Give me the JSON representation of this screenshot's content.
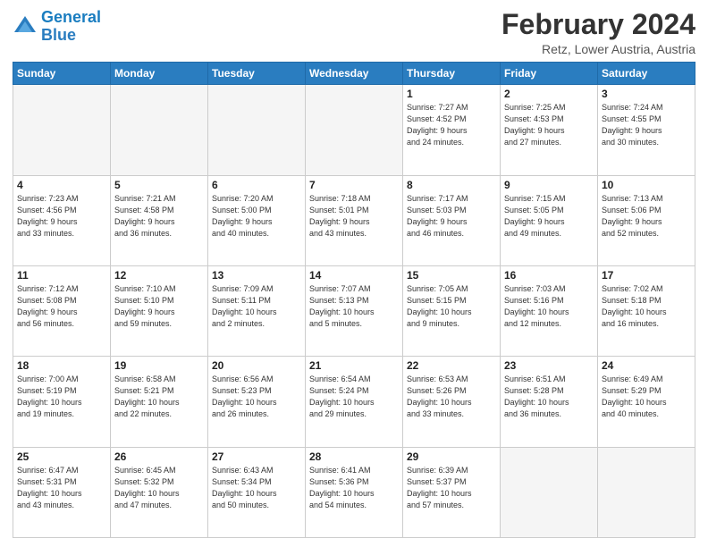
{
  "header": {
    "logo_line1": "General",
    "logo_line2": "Blue",
    "month_title": "February 2024",
    "location": "Retz, Lower Austria, Austria"
  },
  "days_of_week": [
    "Sunday",
    "Monday",
    "Tuesday",
    "Wednesday",
    "Thursday",
    "Friday",
    "Saturday"
  ],
  "weeks": [
    [
      {
        "day": "",
        "info": ""
      },
      {
        "day": "",
        "info": ""
      },
      {
        "day": "",
        "info": ""
      },
      {
        "day": "",
        "info": ""
      },
      {
        "day": "1",
        "info": "Sunrise: 7:27 AM\nSunset: 4:52 PM\nDaylight: 9 hours\nand 24 minutes."
      },
      {
        "day": "2",
        "info": "Sunrise: 7:25 AM\nSunset: 4:53 PM\nDaylight: 9 hours\nand 27 minutes."
      },
      {
        "day": "3",
        "info": "Sunrise: 7:24 AM\nSunset: 4:55 PM\nDaylight: 9 hours\nand 30 minutes."
      }
    ],
    [
      {
        "day": "4",
        "info": "Sunrise: 7:23 AM\nSunset: 4:56 PM\nDaylight: 9 hours\nand 33 minutes."
      },
      {
        "day": "5",
        "info": "Sunrise: 7:21 AM\nSunset: 4:58 PM\nDaylight: 9 hours\nand 36 minutes."
      },
      {
        "day": "6",
        "info": "Sunrise: 7:20 AM\nSunset: 5:00 PM\nDaylight: 9 hours\nand 40 minutes."
      },
      {
        "day": "7",
        "info": "Sunrise: 7:18 AM\nSunset: 5:01 PM\nDaylight: 9 hours\nand 43 minutes."
      },
      {
        "day": "8",
        "info": "Sunrise: 7:17 AM\nSunset: 5:03 PM\nDaylight: 9 hours\nand 46 minutes."
      },
      {
        "day": "9",
        "info": "Sunrise: 7:15 AM\nSunset: 5:05 PM\nDaylight: 9 hours\nand 49 minutes."
      },
      {
        "day": "10",
        "info": "Sunrise: 7:13 AM\nSunset: 5:06 PM\nDaylight: 9 hours\nand 52 minutes."
      }
    ],
    [
      {
        "day": "11",
        "info": "Sunrise: 7:12 AM\nSunset: 5:08 PM\nDaylight: 9 hours\nand 56 minutes."
      },
      {
        "day": "12",
        "info": "Sunrise: 7:10 AM\nSunset: 5:10 PM\nDaylight: 9 hours\nand 59 minutes."
      },
      {
        "day": "13",
        "info": "Sunrise: 7:09 AM\nSunset: 5:11 PM\nDaylight: 10 hours\nand 2 minutes."
      },
      {
        "day": "14",
        "info": "Sunrise: 7:07 AM\nSunset: 5:13 PM\nDaylight: 10 hours\nand 5 minutes."
      },
      {
        "day": "15",
        "info": "Sunrise: 7:05 AM\nSunset: 5:15 PM\nDaylight: 10 hours\nand 9 minutes."
      },
      {
        "day": "16",
        "info": "Sunrise: 7:03 AM\nSunset: 5:16 PM\nDaylight: 10 hours\nand 12 minutes."
      },
      {
        "day": "17",
        "info": "Sunrise: 7:02 AM\nSunset: 5:18 PM\nDaylight: 10 hours\nand 16 minutes."
      }
    ],
    [
      {
        "day": "18",
        "info": "Sunrise: 7:00 AM\nSunset: 5:19 PM\nDaylight: 10 hours\nand 19 minutes."
      },
      {
        "day": "19",
        "info": "Sunrise: 6:58 AM\nSunset: 5:21 PM\nDaylight: 10 hours\nand 22 minutes."
      },
      {
        "day": "20",
        "info": "Sunrise: 6:56 AM\nSunset: 5:23 PM\nDaylight: 10 hours\nand 26 minutes."
      },
      {
        "day": "21",
        "info": "Sunrise: 6:54 AM\nSunset: 5:24 PM\nDaylight: 10 hours\nand 29 minutes."
      },
      {
        "day": "22",
        "info": "Sunrise: 6:53 AM\nSunset: 5:26 PM\nDaylight: 10 hours\nand 33 minutes."
      },
      {
        "day": "23",
        "info": "Sunrise: 6:51 AM\nSunset: 5:28 PM\nDaylight: 10 hours\nand 36 minutes."
      },
      {
        "day": "24",
        "info": "Sunrise: 6:49 AM\nSunset: 5:29 PM\nDaylight: 10 hours\nand 40 minutes."
      }
    ],
    [
      {
        "day": "25",
        "info": "Sunrise: 6:47 AM\nSunset: 5:31 PM\nDaylight: 10 hours\nand 43 minutes."
      },
      {
        "day": "26",
        "info": "Sunrise: 6:45 AM\nSunset: 5:32 PM\nDaylight: 10 hours\nand 47 minutes."
      },
      {
        "day": "27",
        "info": "Sunrise: 6:43 AM\nSunset: 5:34 PM\nDaylight: 10 hours\nand 50 minutes."
      },
      {
        "day": "28",
        "info": "Sunrise: 6:41 AM\nSunset: 5:36 PM\nDaylight: 10 hours\nand 54 minutes."
      },
      {
        "day": "29",
        "info": "Sunrise: 6:39 AM\nSunset: 5:37 PM\nDaylight: 10 hours\nand 57 minutes."
      },
      {
        "day": "",
        "info": ""
      },
      {
        "day": "",
        "info": ""
      }
    ]
  ]
}
